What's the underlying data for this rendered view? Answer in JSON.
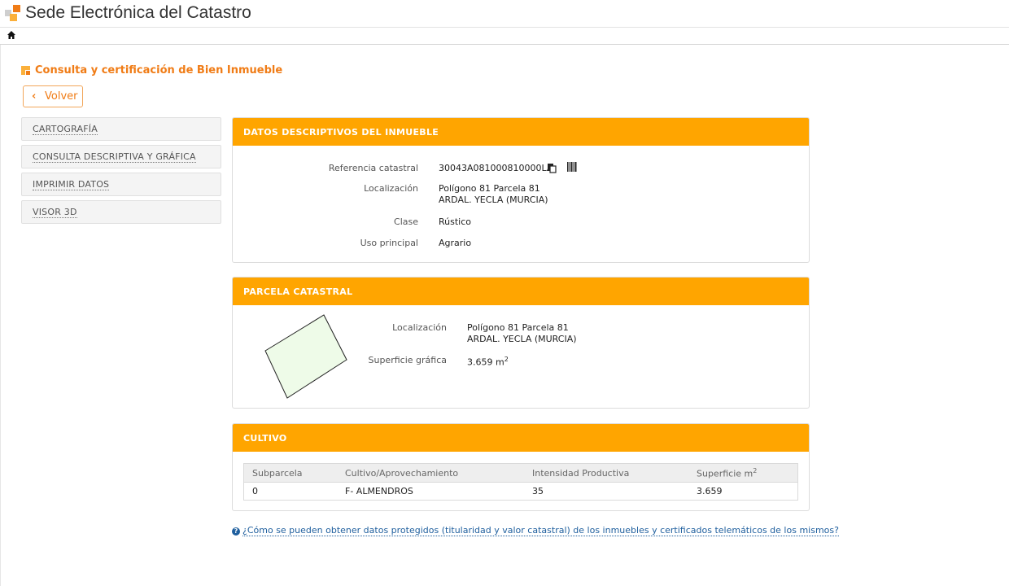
{
  "header": {
    "site_title": "Sede Electrónica del Catastro",
    "logo_icon": "catastro-logo",
    "home_icon": "home-icon"
  },
  "page": {
    "title": "Consulta y certificación de Bien Inmueble",
    "back_label": "Volver"
  },
  "sidebar": {
    "items": [
      {
        "label": "CARTOGRAFÍA"
      },
      {
        "label": "CONSULTA DESCRIPTIVA Y GRÁFICA"
      },
      {
        "label": "IMPRIMIR DATOS"
      },
      {
        "label": "VISOR 3D"
      }
    ]
  },
  "datos": {
    "header": "DATOS DESCRIPTIVOS DEL INMUEBLE",
    "ref_label": "Referencia catastral",
    "ref_value": "30043A081000810000LA",
    "loc_label": "Localización",
    "loc_line1": "Polígono 81 Parcela 81",
    "loc_line2": "ARDAL. YECLA (MURCIA)",
    "clase_label": "Clase",
    "clase_value": "Rústico",
    "uso_label": "Uso principal",
    "uso_value": "Agrario"
  },
  "parcela": {
    "header": "PARCELA CATASTRAL",
    "loc_label": "Localización",
    "loc_line1": "Polígono 81 Parcela 81",
    "loc_line2": "ARDAL. YECLA (MURCIA)",
    "sup_label": "Superficie gráfica",
    "sup_value": "3.659 m",
    "sup_unit_exp": "2",
    "fill_color": "#eefbe8"
  },
  "cultivo": {
    "header": "CULTIVO",
    "columns": [
      "Subparcela",
      "Cultivo/Aprovechamiento",
      "Intensidad Productiva",
      "Superficie m"
    ],
    "columns_sup": "2",
    "rows": [
      [
        "0",
        "F- ALMENDROS",
        "35",
        "3.659"
      ]
    ]
  },
  "help": {
    "icon": "question-circle-icon",
    "text": "¿Cómo se pueden obtener datos protegidos (titularidad y valor catastral) de los inmuebles y certificados telemáticos de los mismos?"
  },
  "colors": {
    "accent": "#ffa500",
    "title_orange": "#f07c16",
    "link_blue": "#1f5f9e"
  }
}
